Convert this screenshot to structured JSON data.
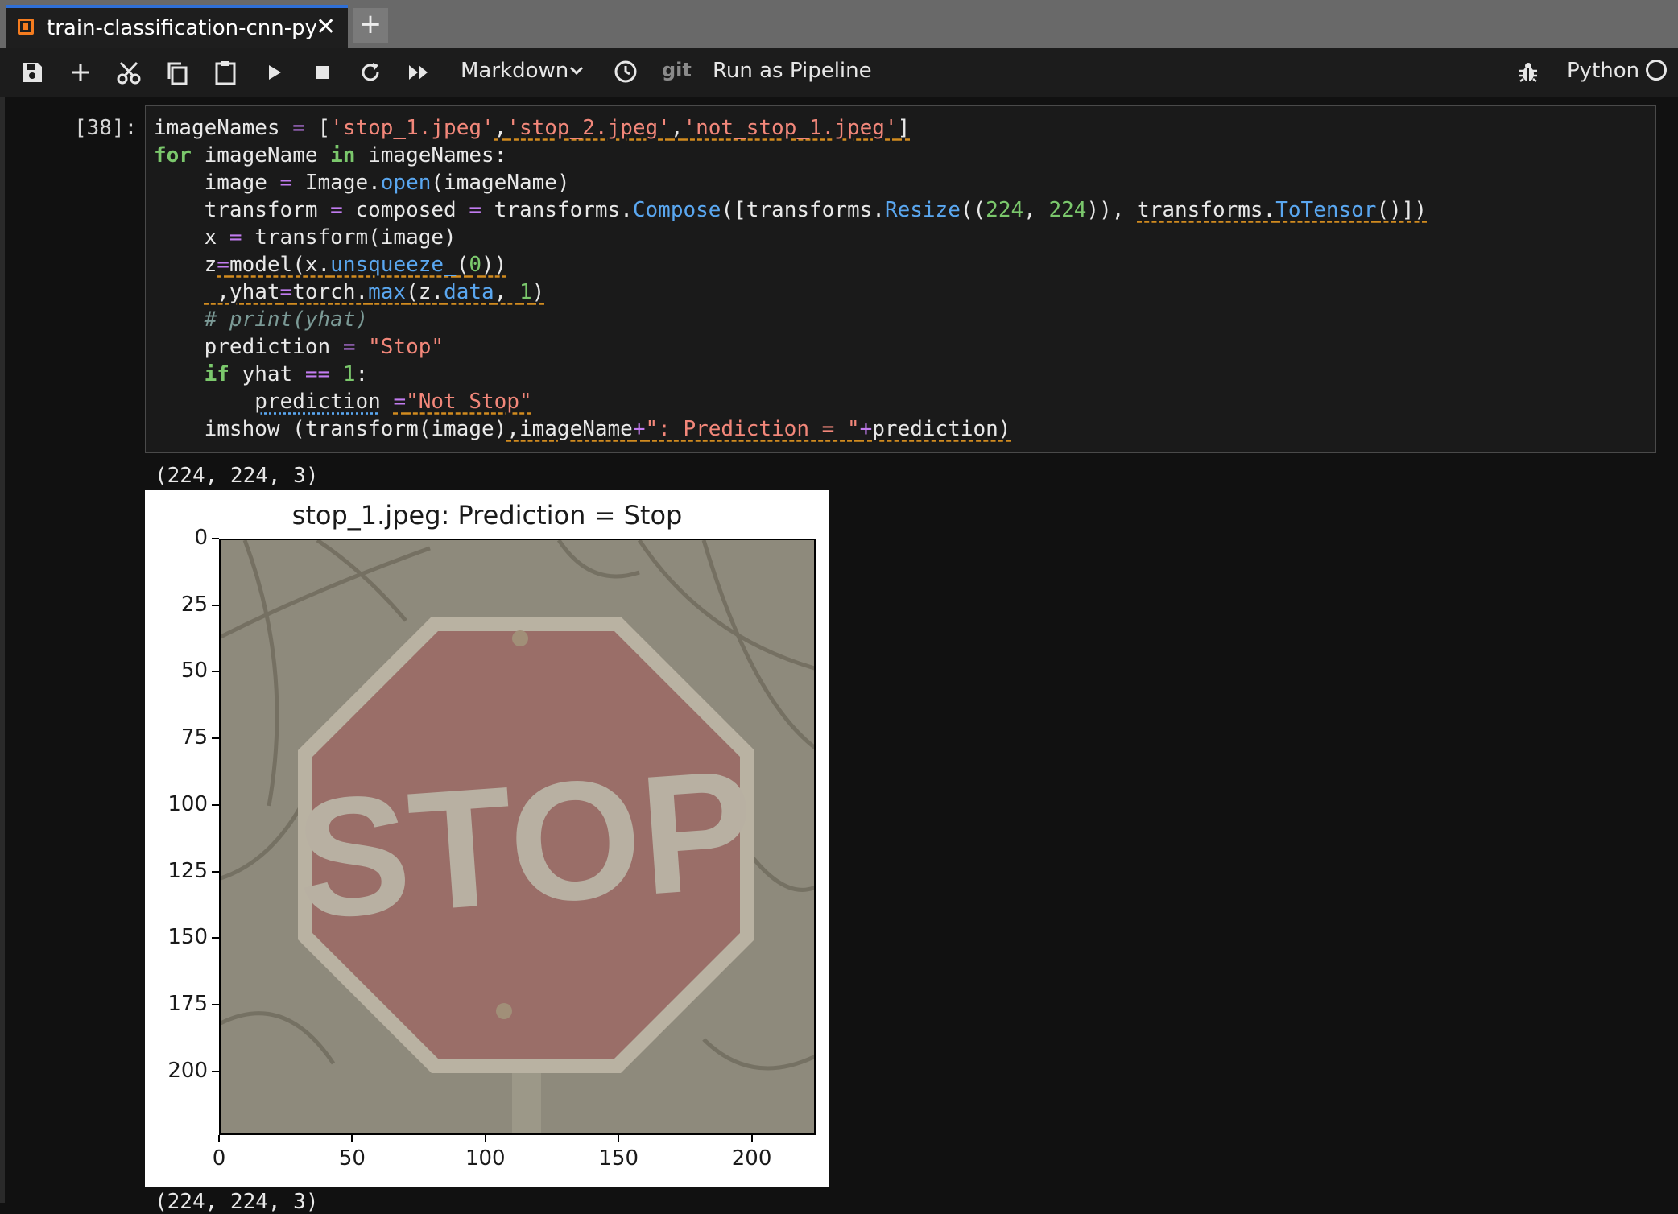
{
  "tab": {
    "title": "train-classification-cnn-pytc",
    "close": "✕",
    "new_tab": "+"
  },
  "toolbar": {
    "cell_type": "Markdown",
    "git_label": "git",
    "run_pipeline": "Run as Pipeline",
    "kernel": "Python",
    "icons": [
      "save-icon",
      "add-icon",
      "cut-icon",
      "copy-icon",
      "paste-icon",
      "run-icon",
      "stop-icon",
      "restart-icon",
      "fast-forward-icon",
      "chevron-down-icon",
      "clock-icon",
      "bug-icon",
      "kernel-status-icon"
    ]
  },
  "cell": {
    "prompt": "[38]:",
    "output_1": "(224, 224, 3)",
    "output_2": "(224, 224, 3)"
  },
  "figure": {
    "title": "stop_1.jpeg: Prediction = Stop",
    "sign_text": "STOP"
  },
  "chart_data": {
    "type": "image",
    "title": "stop_1.jpeg: Prediction = Stop",
    "xlim": [
      0,
      224
    ],
    "ylim": [
      224,
      0
    ],
    "xticks": [
      0,
      50,
      100,
      150,
      200
    ],
    "yticks": [
      0,
      25,
      50,
      75,
      100,
      125,
      150,
      175,
      200
    ],
    "xlabel": "",
    "ylabel": ""
  },
  "colors": {
    "tab_accent": "#2f6fd6",
    "notebook_icon": "#f57c1f",
    "keyword": "#7bc86c",
    "operator": "#c27cf0",
    "string": "#f2877a",
    "function": "#5aa7f0"
  }
}
